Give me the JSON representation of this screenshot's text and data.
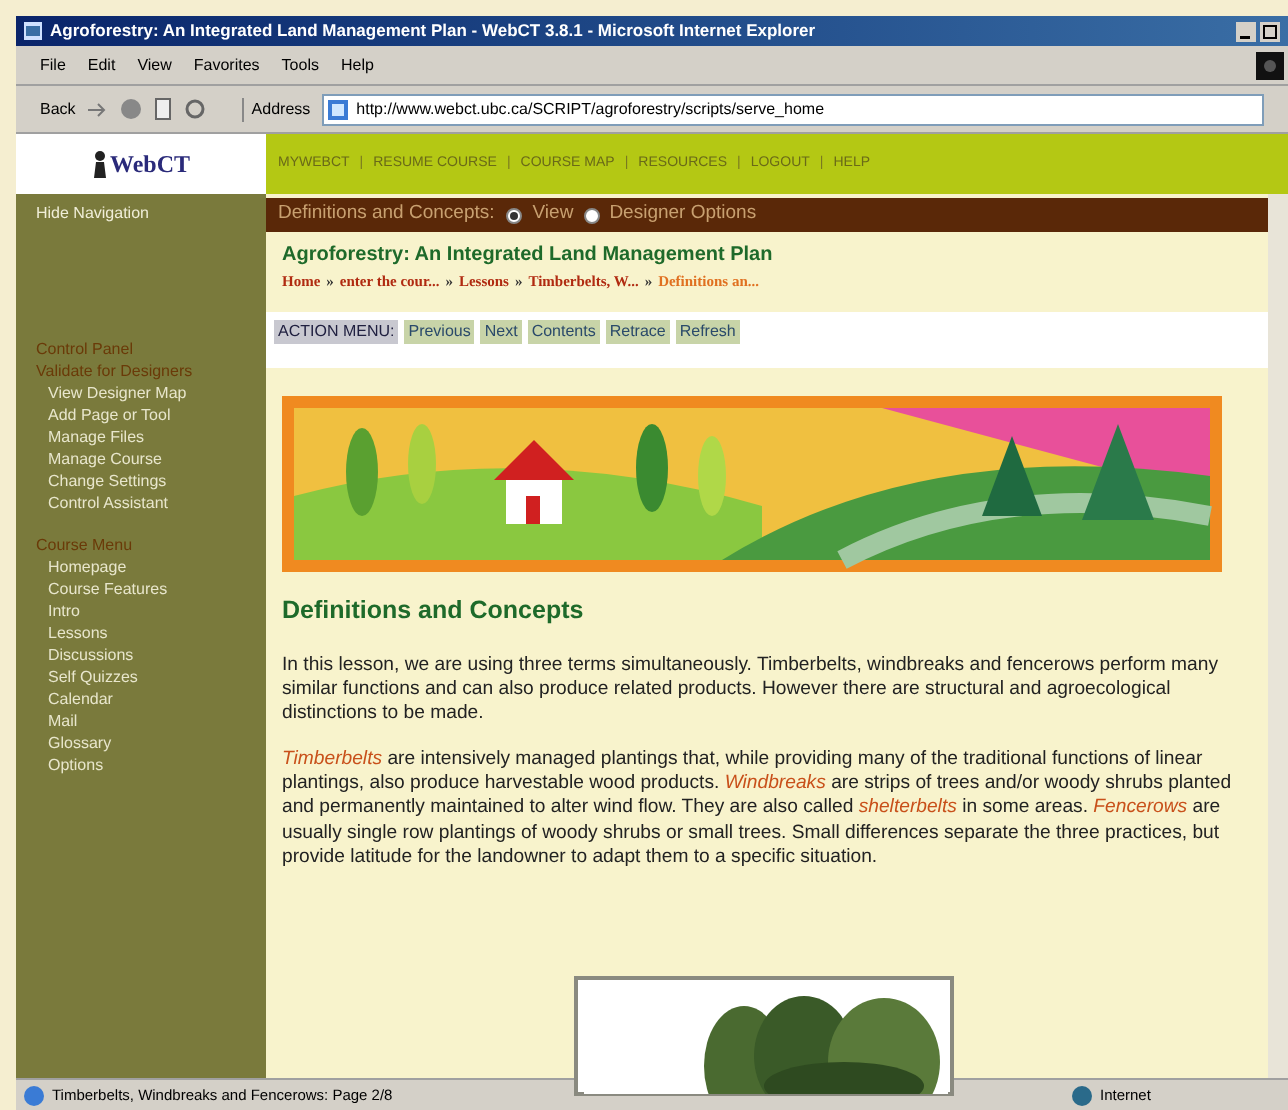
{
  "window": {
    "title": "Agroforestry: An Integrated Land Management Plan - WebCT 3.8.1 - Microsoft Internet Explorer"
  },
  "menu_bar": [
    "File",
    "Edit",
    "View",
    "Favorites",
    "Tools",
    "Help"
  ],
  "toolbar": {
    "back": "Back",
    "address_label": "Address",
    "url": "http://www.webct.ubc.ca/SCRIPT/agroforestry/scripts/serve_home"
  },
  "webct": {
    "logo": "WebCT",
    "separator": "|",
    "nav": [
      "MYWEBCT",
      "RESUME COURSE",
      "COURSE MAP",
      "RESOURCES",
      "LOGOUT",
      "HELP"
    ]
  },
  "sidebar": {
    "hide": "Hide Navigation",
    "sections": [
      {
        "title": "Control Panel",
        "items": [
          {
            "label": "Validate for Designers",
            "kind": "heading"
          },
          {
            "label": "View Designer Map",
            "kind": "link"
          },
          {
            "label": "Add Page or Tool",
            "kind": "link"
          },
          {
            "label": "Manage Files",
            "kind": "link"
          },
          {
            "label": "Manage Course",
            "kind": "link"
          },
          {
            "label": "Change Settings",
            "kind": "link"
          },
          {
            "label": "Control Assistant",
            "kind": "link"
          }
        ]
      },
      {
        "title": "Course Menu",
        "items": [
          {
            "label": "Homepage",
            "kind": "link"
          },
          {
            "label": "Course Features",
            "kind": "link"
          },
          {
            "label": "Intro",
            "kind": "link"
          },
          {
            "label": "Lessons",
            "kind": "link"
          },
          {
            "label": "Discussions",
            "kind": "link"
          },
          {
            "label": "Self Quizzes",
            "kind": "link"
          },
          {
            "label": "Calendar",
            "kind": "link"
          },
          {
            "label": "Mail",
            "kind": "link"
          },
          {
            "label": "Glossary",
            "kind": "link"
          },
          {
            "label": "Options",
            "kind": "link"
          }
        ]
      }
    ]
  },
  "page_bar": {
    "title": "Definitions and Concepts:",
    "options": [
      {
        "label": "View",
        "selected": true
      },
      {
        "label": "Designer Options",
        "selected": false
      }
    ]
  },
  "course_title": "Agroforestry: An Integrated Land Management Plan",
  "breadcrumbs": {
    "separator": "»",
    "items": [
      {
        "label": "Home",
        "current": false
      },
      {
        "label": "enter the cour...",
        "current": false
      },
      {
        "label": "Lessons",
        "current": false
      },
      {
        "label": "Timberbelts, W...",
        "current": false
      },
      {
        "label": "Definitions an...",
        "current": true
      }
    ]
  },
  "action_menu": {
    "label": "ACTION MENU:",
    "buttons": [
      "Previous",
      "Next",
      "Contents",
      "Retrace",
      "Refresh"
    ]
  },
  "content": {
    "heading": "Definitions and Concepts",
    "paragraphs": [
      "In this lesson, we are using three terms simultaneously.  Timberbelts, windbreaks and fencerows perform many similar functions and can also produce related products. However there are structural and agroecological distinctions to be made.",
      "*Timberbelts* are intensively managed plantings that, while providing many of the traditional functions of linear plantings, also produce harvestable wood products. *Windbreaks* are strips of trees and/or woody shrubs planted and permanently maintained to alter wind flow.  They are also called *shelterbelts* in some areas.  *Fencerows* are usually single row plantings of woody shrubs or small trees.  Small differences separate the three practices, but provide latitude for the landowner to adapt them to a specific situation."
    ]
  },
  "status_bar": {
    "text": "Timberbelts, Windbreaks and Fencerows: Page 2/8",
    "zone": "Internet"
  }
}
